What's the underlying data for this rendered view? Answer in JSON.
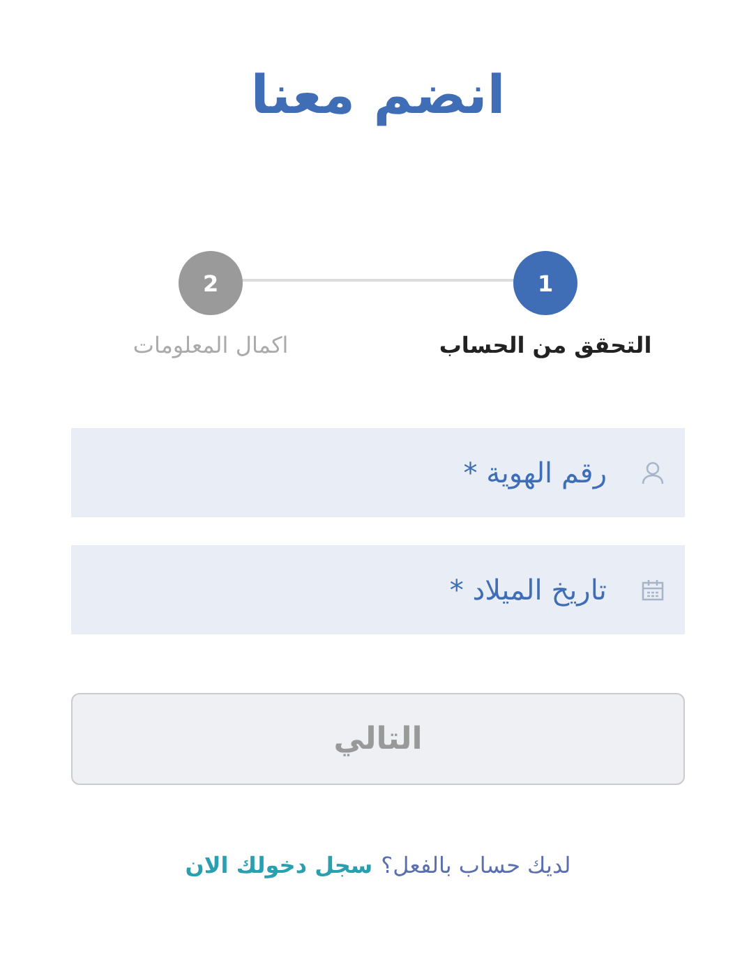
{
  "title": "انضم معنا",
  "steps": [
    {
      "number": "1",
      "label": "التحقق من الحساب",
      "selected": true
    },
    {
      "number": "2",
      "label": "اكمال المعلومات",
      "selected": false
    }
  ],
  "fields": [
    {
      "kind": "user",
      "placeholder": "رقم الهوية *"
    },
    {
      "kind": "date",
      "placeholder": "تاريخ الميلاد *"
    }
  ],
  "next_button": {
    "label": "التالي",
    "disabled": true
  },
  "footer": {
    "question": "لديك حساب بالفعل؟",
    "link": "سجل دخولك الان"
  }
}
